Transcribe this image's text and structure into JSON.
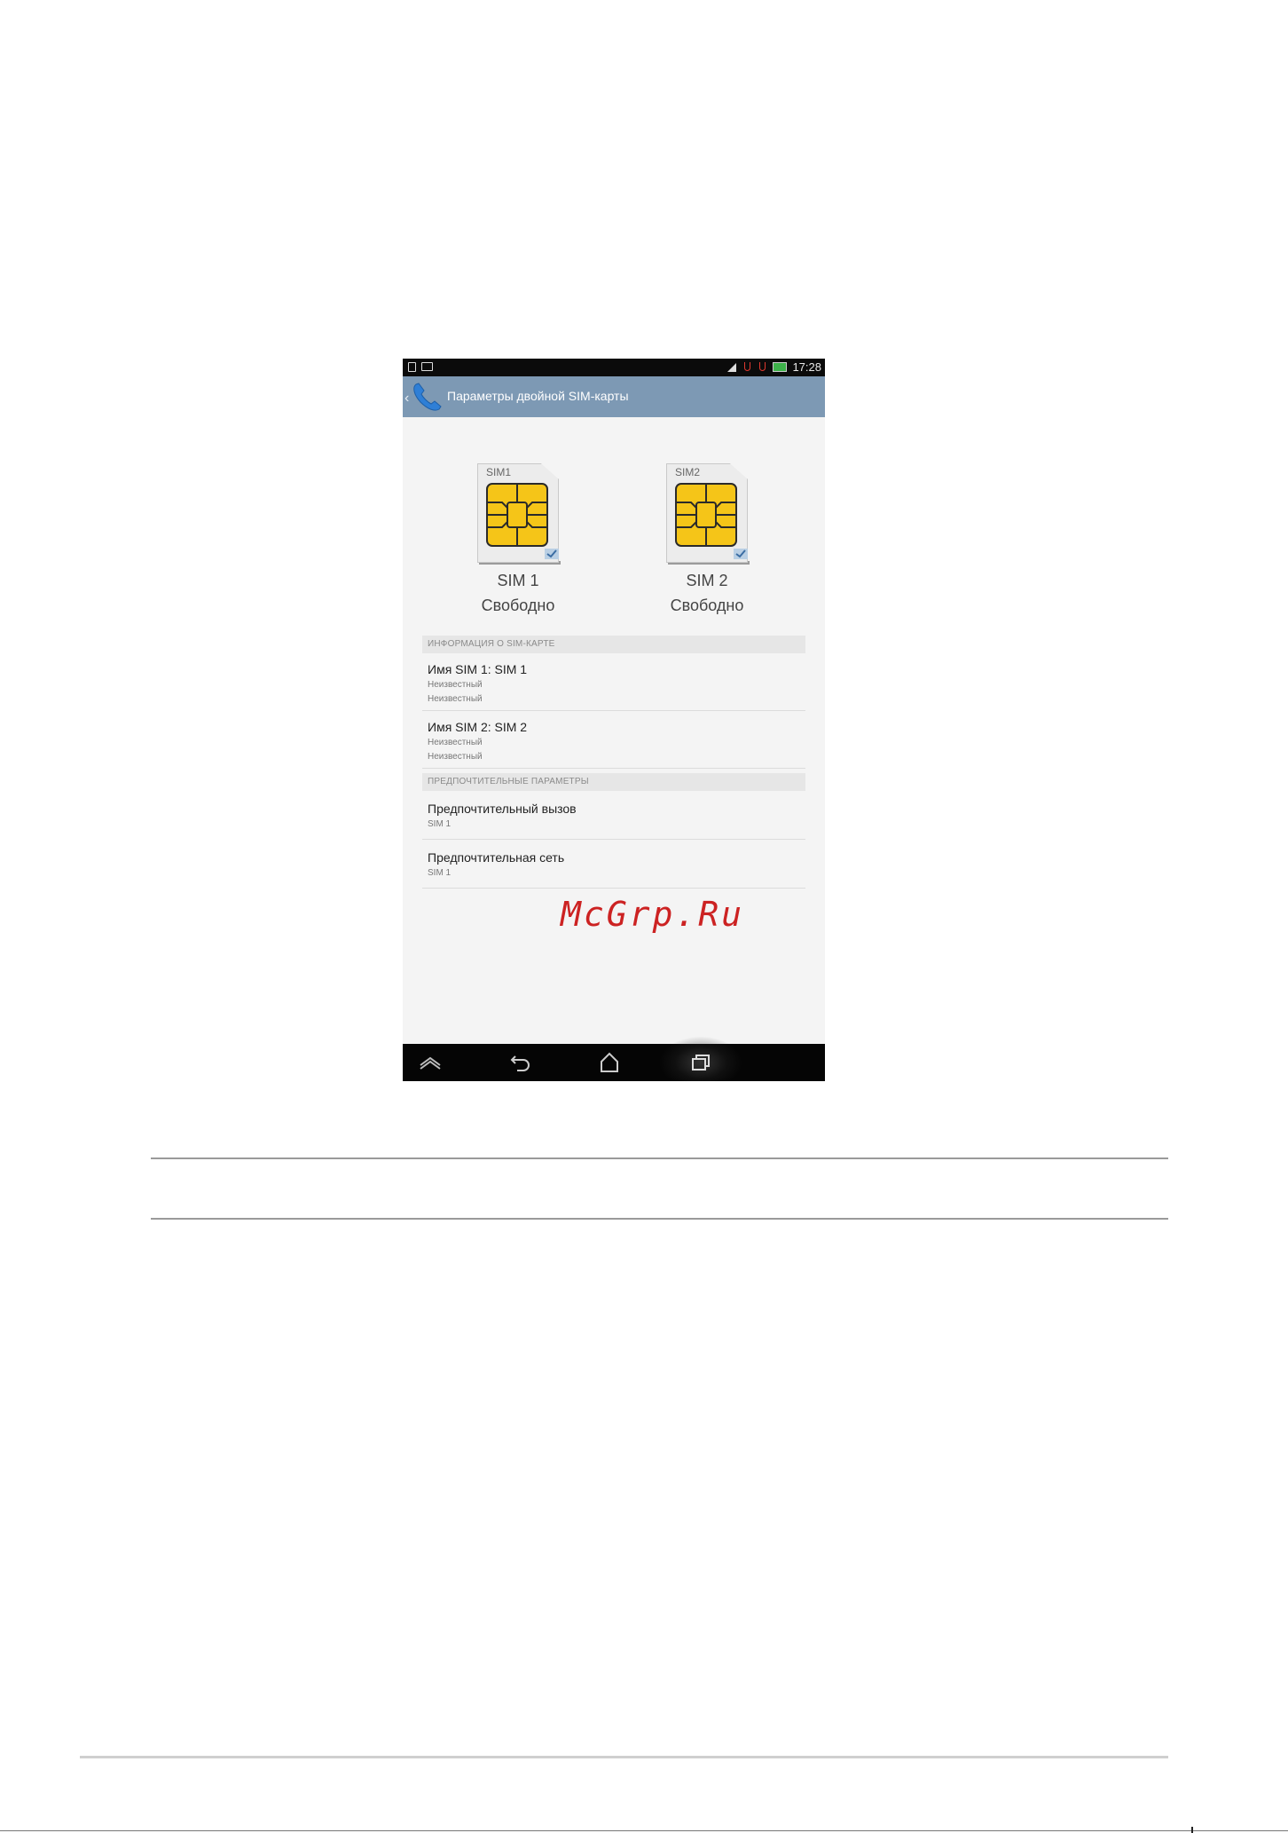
{
  "status_bar": {
    "time": "17:28"
  },
  "action_bar": {
    "title": "Параметры двойной SIM-карты"
  },
  "sims": [
    {
      "card_label": "SIM1",
      "name": "SIM 1",
      "status": "Свободно"
    },
    {
      "card_label": "SIM2",
      "name": "SIM 2",
      "status": "Свободно"
    }
  ],
  "sections": {
    "sim_info": {
      "header": "ИНФОРМАЦИЯ О SIM-КАРТЕ",
      "items": [
        {
          "title": "Имя SIM 1: SIM 1",
          "line1": "Неизвестный",
          "line2": "Неизвестный"
        },
        {
          "title": "Имя SIM 2: SIM 2",
          "line1": "Неизвестный",
          "line2": "Неизвестный"
        }
      ]
    },
    "preferred": {
      "header": "ПРЕДПОЧТИТЕЛЬНЫЕ ПАРАМЕТРЫ",
      "items": [
        {
          "title": "Предпочтительный вызов",
          "value": "SIM 1"
        },
        {
          "title": "Предпочтительная сеть",
          "value": "SIM 1"
        }
      ]
    }
  },
  "nav_bar": {
    "icons": [
      "asus-menu-icon",
      "back-icon",
      "home-icon",
      "recent-apps-icon"
    ]
  },
  "watermark": "McGrp.Ru",
  "colors": {
    "action_bar": "#7d99b4",
    "chip_gold": "#f5c518",
    "watermark_red": "#cc2222",
    "background": "#f4f4f4"
  }
}
